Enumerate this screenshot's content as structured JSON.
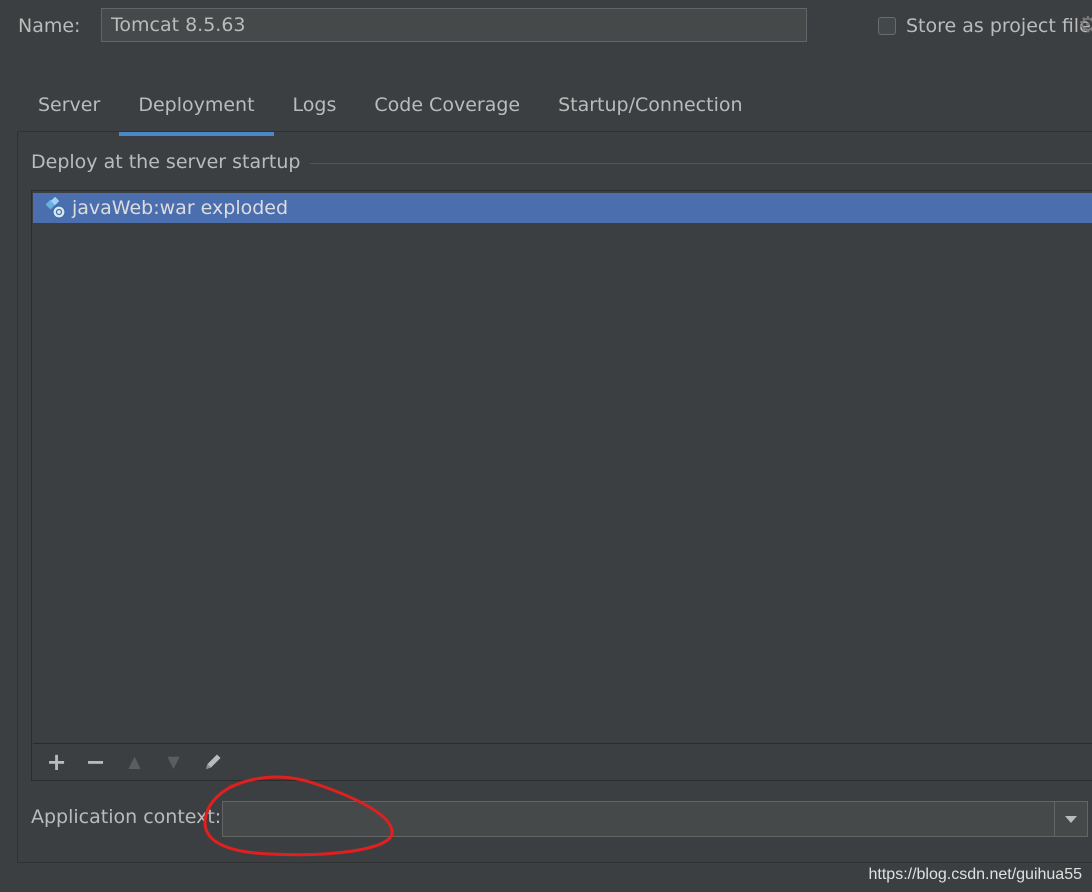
{
  "header": {
    "name_label": "Name:",
    "name_value": "Tomcat 8.5.63",
    "store_label": "Store as project file",
    "store_checked": false,
    "settings_icon": "gear-icon"
  },
  "tabs": [
    {
      "label": "Server",
      "active": false
    },
    {
      "label": "Deployment",
      "active": true
    },
    {
      "label": "Logs",
      "active": false
    },
    {
      "label": "Code Coverage",
      "active": false
    },
    {
      "label": "Startup/Connection",
      "active": false
    }
  ],
  "deploy": {
    "title": "Deploy at the server startup",
    "items": [
      {
        "label": "javaWeb:war exploded",
        "icon": "war-exploded-artifact-icon",
        "selected": true
      }
    ],
    "toolbar": {
      "add": "+",
      "remove": "−",
      "up": "▲",
      "down": "▼",
      "edit": "pencil-icon"
    }
  },
  "context": {
    "label": "Application context:",
    "value": ""
  },
  "colors": {
    "background": "#3c3f41",
    "selection": "#4b6eaf",
    "tab_underline": "#4a88c7",
    "annotation": "#e02020"
  },
  "watermark": "https://blog.csdn.net/guihua55"
}
